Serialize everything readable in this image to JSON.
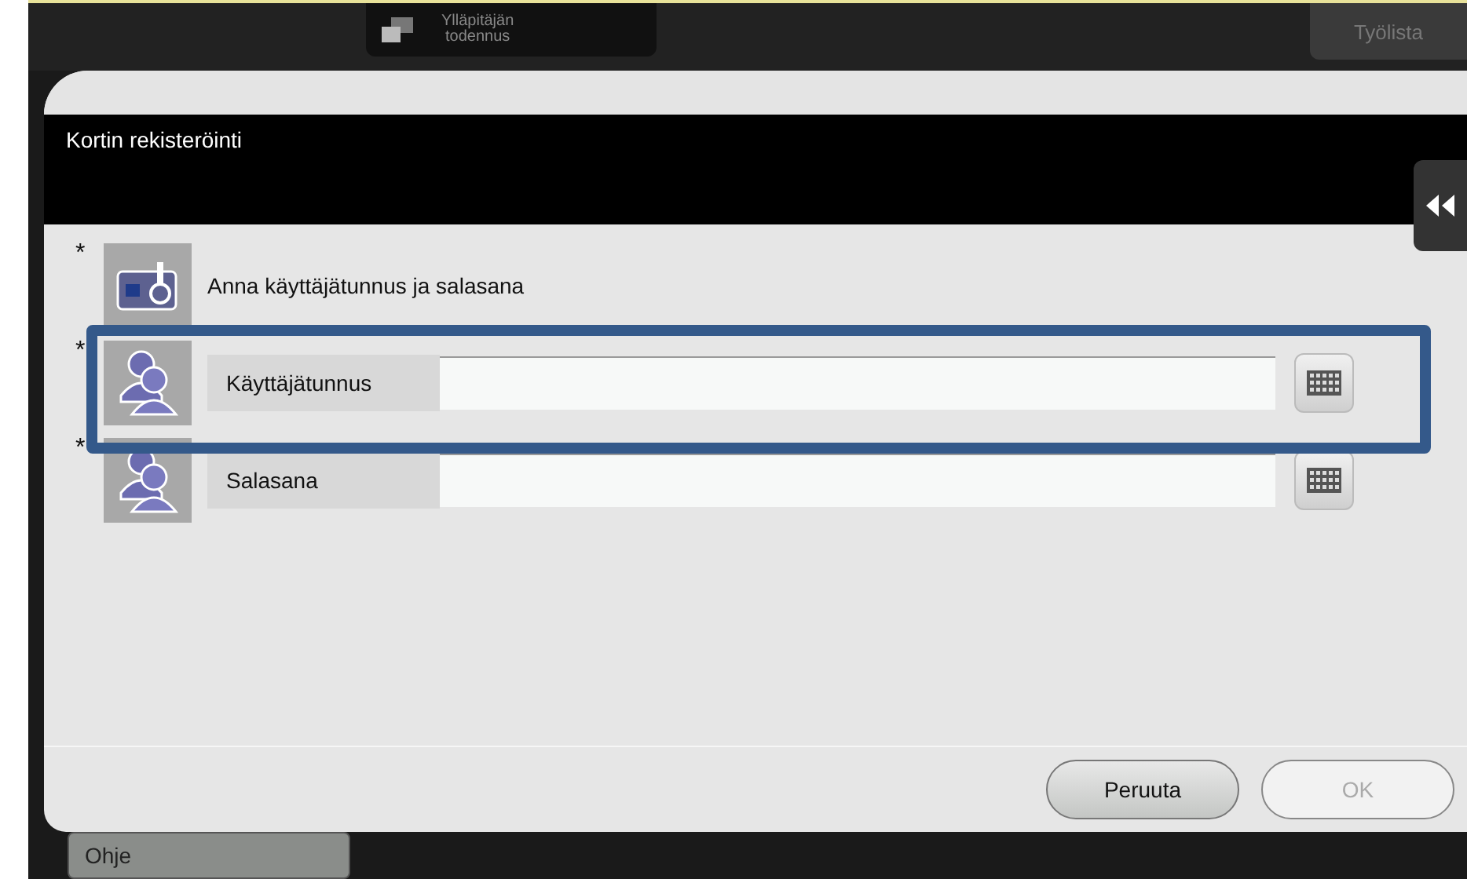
{
  "top_bar": {
    "admin_button": {
      "label": "Ylläpitäjän\ntodennus"
    },
    "job_list_button": {
      "label": "Työlista"
    }
  },
  "dialog": {
    "title": "Kortin rekisteröinti",
    "instruction": {
      "text": "Anna käyttäjätunnus ja salasana",
      "required_mark": "*"
    },
    "fields": [
      {
        "label": "Käyttäjätunnus",
        "required_mark": "*",
        "highlighted": true
      },
      {
        "label": "Salasana",
        "required_mark": "*",
        "highlighted": false
      }
    ],
    "buttons": [
      {
        "label": "Peruuta",
        "disabled": false
      },
      {
        "label": "OK",
        "disabled": true
      }
    ]
  },
  "bottom_bar": {
    "help_button": {
      "label": "Ohje"
    }
  }
}
